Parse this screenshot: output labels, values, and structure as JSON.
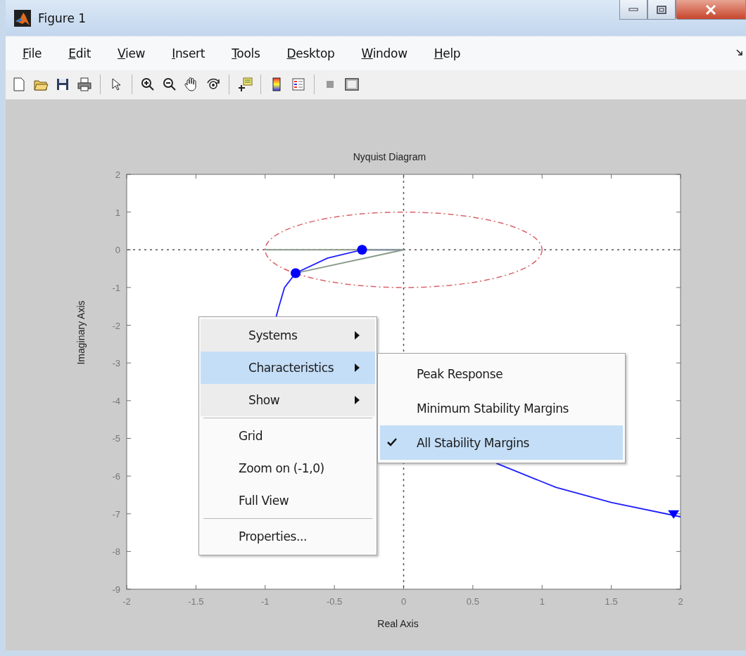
{
  "window": {
    "title": "Figure 1"
  },
  "menu_bar": [
    "File",
    "Edit",
    "View",
    "Insert",
    "Tools",
    "Desktop",
    "Window",
    "Help"
  ],
  "figure": {
    "chart_data": {
      "type": "line",
      "title": "Nyquist Diagram",
      "xlabel": "Real Axis",
      "ylabel": "Imaginary Axis",
      "xlim": [
        -2,
        2
      ],
      "ylim": [
        -9,
        2
      ],
      "xticks": [
        -2,
        -1.5,
        -1,
        -0.5,
        0,
        0.5,
        1,
        1.5,
        2
      ],
      "yticks": [
        -9,
        -8,
        -7,
        -6,
        -5,
        -4,
        -3,
        -2,
        -1,
        0,
        1,
        2
      ],
      "x": [
        -0.02,
        -0.3,
        -0.55,
        -0.78,
        -0.86,
        -0.9,
        -0.92,
        0,
        0.67,
        1.1,
        1.5,
        2.0
      ],
      "series": [
        {
          "color": "#1f1fff",
          "values": [
            0,
            0,
            -0.22,
            -0.62,
            -1.0,
            -1.5,
            -1.77,
            null,
            -5.66,
            -6.3,
            -6.7,
            -7.08
          ]
        }
      ]
    }
  },
  "context_menu": {
    "groups": [
      [
        {
          "label": "Systems",
          "kind": "submenu",
          "selected": false
        },
        {
          "label": "Characteristics",
          "kind": "submenu",
          "selected": true
        },
        {
          "label": "Show",
          "kind": "submenu",
          "selected": false
        }
      ],
      [
        {
          "label": "Grid",
          "kind": "command",
          "selected": false
        },
        {
          "label": "Zoom on (-1,0)",
          "kind": "command",
          "selected": false
        },
        {
          "label": "Full View",
          "kind": "command",
          "selected": false
        }
      ],
      [
        {
          "label": "Properties...",
          "kind": "command",
          "selected": false
        }
      ]
    ]
  },
  "submenu": {
    "items": [
      {
        "label": "Peak Response",
        "checked": false,
        "selected": false
      },
      {
        "label": "Minimum Stability Margins",
        "checked": false,
        "selected": false
      },
      {
        "label": "All Stability Margins",
        "checked": true,
        "selected": true
      }
    ]
  }
}
